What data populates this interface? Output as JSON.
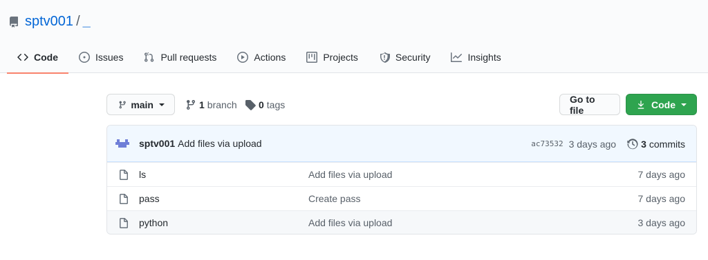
{
  "repo": {
    "owner": "sptv001",
    "separator": "/",
    "name": "_"
  },
  "tabs": [
    {
      "label": "Code",
      "icon": "code-icon",
      "selected": true
    },
    {
      "label": "Issues",
      "icon": "issue-opened-icon"
    },
    {
      "label": "Pull requests",
      "icon": "git-pull-request-icon"
    },
    {
      "label": "Actions",
      "icon": "play-icon"
    },
    {
      "label": "Projects",
      "icon": "project-icon"
    },
    {
      "label": "Security",
      "icon": "shield-icon"
    },
    {
      "label": "Insights",
      "icon": "graph-icon"
    }
  ],
  "toolbar": {
    "branch": "main",
    "branch_count": "1",
    "branch_label": "branch",
    "tag_count": "0",
    "tag_label": "tags",
    "goto_file": "Go to file",
    "code": "Code"
  },
  "commit": {
    "author": "sptv001",
    "message": "Add files via upload",
    "sha": "ac73532",
    "age": "3 days ago",
    "count": "3",
    "count_label": "commits"
  },
  "files": [
    {
      "name": "ls",
      "message": "Add files via upload",
      "age": "7 days ago"
    },
    {
      "name": "pass",
      "message": "Create pass",
      "age": "7 days ago"
    },
    {
      "name": "python",
      "message": "Add files via upload",
      "age": "3 days ago"
    }
  ],
  "colors": {
    "link": "#0366d6",
    "tab_underline": "#f9826c",
    "primary_button": "#2ea44f",
    "commit_bar": "#f1f8ff"
  }
}
